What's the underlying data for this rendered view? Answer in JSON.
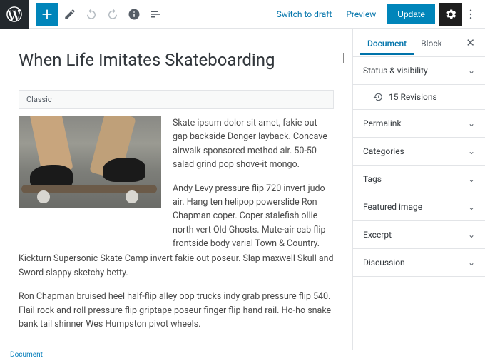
{
  "toolbar": {
    "switch_draft": "Switch to draft",
    "preview": "Preview",
    "update": "Update"
  },
  "sidebar": {
    "tabs": {
      "document": "Document",
      "block": "Block"
    },
    "panels": {
      "status": "Status & visibility",
      "revisions": "15 Revisions",
      "permalink": "Permalink",
      "categories": "Categories",
      "tags": "Tags",
      "featured": "Featured image",
      "excerpt": "Excerpt",
      "discussion": "Discussion"
    }
  },
  "post": {
    "title": "When Life Imitates Skateboarding",
    "block_label": "Classic",
    "p1": "Skate ipsum dolor sit amet, fakie out gap backside Donger layback. Concave airwalk sponsored method air. 50-50 salad grind pop shove-it mongo.",
    "p2": "Andy Levy pressure flip 720 invert judo air. Hang ten helipop powerslide Ron Chapman coper. Coper stalefish ollie north vert Old Ghosts. Mute-air cab flip frontside body varial Town & Country.",
    "p3": "Kickturn Supersonic Skate Camp invert fakie out poseur. Slap maxwell Skull and Sword slappy sketchy betty.",
    "p4": "Ron Chapman bruised heel half-flip alley oop trucks indy grab pressure flip 540. Flail rock and roll pressure flip griptape poseur finger flip hand rail. Ho-ho snake bank tail shinner Wes Humpston pivot wheels."
  },
  "footer": {
    "breadcrumb": "Document"
  }
}
